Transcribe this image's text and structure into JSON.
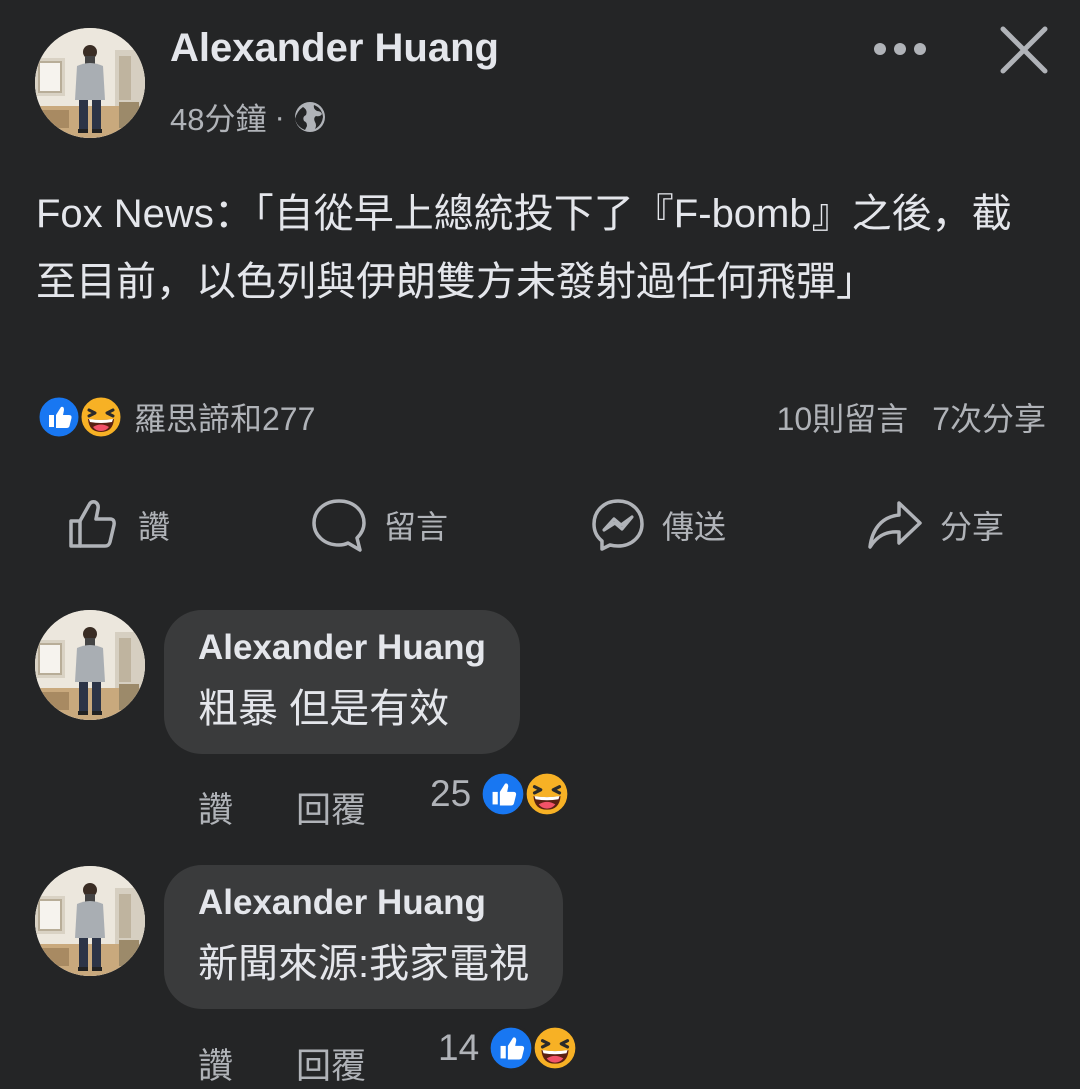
{
  "post": {
    "author": "Alexander Huang",
    "time": "48分鐘",
    "separator": "·",
    "audience_icon": "globe-icon",
    "text": "Fox News：「自從早上總統投下了『F-bomb』之後，截至目前，以色列與伊朗雙方未發射過任何飛彈」"
  },
  "reactions": {
    "icons": [
      "like-icon",
      "haha-icon"
    ],
    "summary": "羅思諦和277",
    "comments": "10則留言",
    "shares": "7次分享"
  },
  "actions": {
    "like": "讚",
    "comment": "留言",
    "send": "傳送",
    "share": "分享"
  },
  "comments": [
    {
      "author": "Alexander Huang",
      "text": "粗暴 但是有效",
      "like": "讚",
      "reply": "回覆",
      "count": "25"
    },
    {
      "author": "Alexander Huang",
      "text": "新聞來源:我家電視",
      "like": "讚",
      "reply": "回覆",
      "count": "14"
    }
  ],
  "colors": {
    "background": "#242526",
    "bubble": "#3a3b3c",
    "text_primary": "#e4e6eb",
    "text_secondary": "#b0b3b8",
    "like_blue": "#1877f2",
    "haha_yellow": "#f7b125"
  }
}
